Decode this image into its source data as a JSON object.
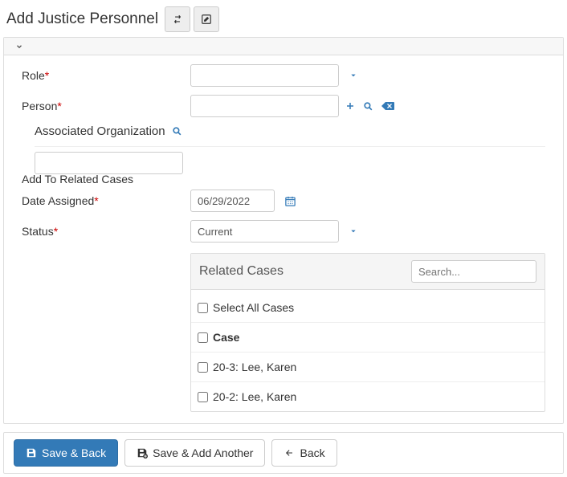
{
  "header": {
    "title": "Add Justice Personnel"
  },
  "form": {
    "role_label": "Role",
    "person_label": "Person",
    "assoc_label": "Associated Organization",
    "date_assigned_label": "Date Assigned",
    "date_assigned_value": "06/29/2022",
    "status_label": "Status",
    "status_value": "Current",
    "add_to_related_label": "Add To Related Cases"
  },
  "related": {
    "title": "Related Cases",
    "search_placeholder": "Search...",
    "select_all_label": "Select All Cases",
    "col_header": "Case",
    "rows": [
      "20-3: Lee, Karen",
      "20-2: Lee, Karen"
    ]
  },
  "footer": {
    "save_back": "Save & Back",
    "save_add": "Save & Add Another",
    "back": "Back"
  }
}
